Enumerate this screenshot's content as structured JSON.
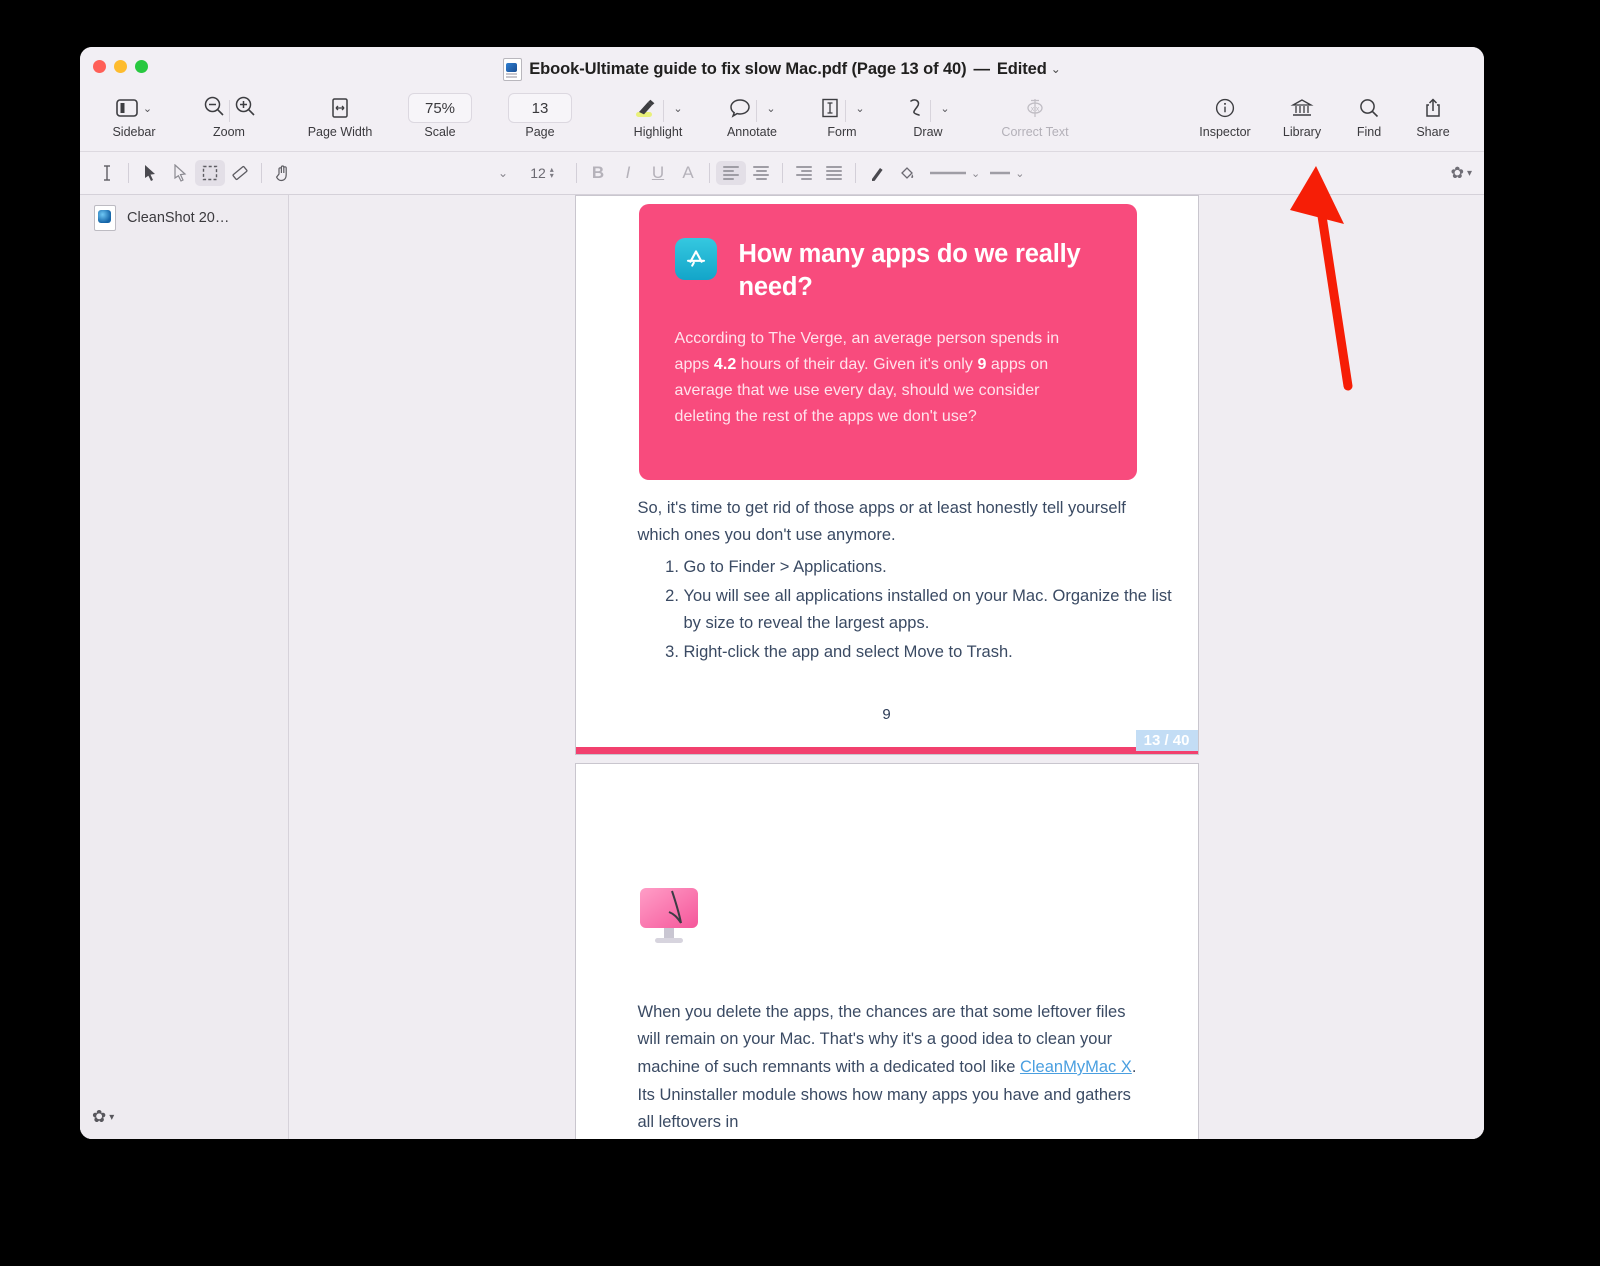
{
  "window": {
    "title": "Ebook-Ultimate guide to fix slow Mac.pdf (Page 13 of 40)",
    "separator": "—",
    "edited": "Edited",
    "chevron": "⌄",
    "traffic": {
      "close": "close-button",
      "minimize": "minimize-button",
      "zoom": "zoom-button"
    }
  },
  "toolbar": {
    "sidebar_label": "Sidebar",
    "zoom_label": "Zoom",
    "page_width_label": "Page Width",
    "scale_label": "Scale",
    "scale_value": "75%",
    "page_label": "Page",
    "page_value": "13",
    "highlight_label": "Highlight",
    "annotate_label": "Annotate",
    "form_label": "Form",
    "draw_label": "Draw",
    "correct_text_label": "Correct Text",
    "inspector_label": "Inspector",
    "library_label": "Library",
    "find_label": "Find",
    "share_label": "Share",
    "chevron": "⌄"
  },
  "format_bar": {
    "font_family_value": "",
    "font_size_value": "12",
    "bold": "B",
    "italic": "I",
    "underline": "U",
    "text_style": "A",
    "chevron": "⌄",
    "gear": "✿"
  },
  "sidebar": {
    "items": [
      {
        "label": "CleanShot 20…"
      }
    ],
    "gear": "✿",
    "gear_chevron": "▾"
  },
  "document": {
    "page_badge": "13 / 40",
    "page1": {
      "callout": {
        "icon": "app-store-icon",
        "title": "How many apps do we really need?",
        "body_parts": [
          {
            "text": "According to The Verge, an average person spends in apps ",
            "bold": false
          },
          {
            "text": "4.2",
            "bold": true
          },
          {
            "text": " hours of their day. Given it's only ",
            "bold": false
          },
          {
            "text": "9",
            "bold": true
          },
          {
            "text": " apps on average that we use every day, should we consider deleting the rest of the apps we don't use?",
            "bold": false
          }
        ]
      },
      "intro_paragraph": "So, it's time to get rid of those apps or at least honestly tell yourself which ones you don't use anymore.",
      "steps": [
        "Go to Finder > Applications.",
        "You will see all applications installed on your Mac. Organize the list by size to reveal the largest apps.",
        "Right-click the app and select Move to Trash."
      ],
      "folio": "9"
    },
    "page2": {
      "paragraph_before_link": "When you delete the apps, the chances are that some leftover files will remain on your Mac. That's why it's a good idea to clean your machine of such remnants with a dedicated tool like ",
      "link_text": "CleanMyMac X",
      "paragraph_after_link": ". Its Uninstaller module shows how many apps you have and gathers all leftovers in"
    }
  },
  "annotation": {
    "arrow_color": "#f61e06",
    "points_to": "Library"
  },
  "colors": {
    "callout_pink": "#f84b7d",
    "page_rule_pink": "#f2406e",
    "badge_blue": "#c3ddf5",
    "link_blue": "#4a9fe0",
    "body_text": "#3a4a63"
  }
}
